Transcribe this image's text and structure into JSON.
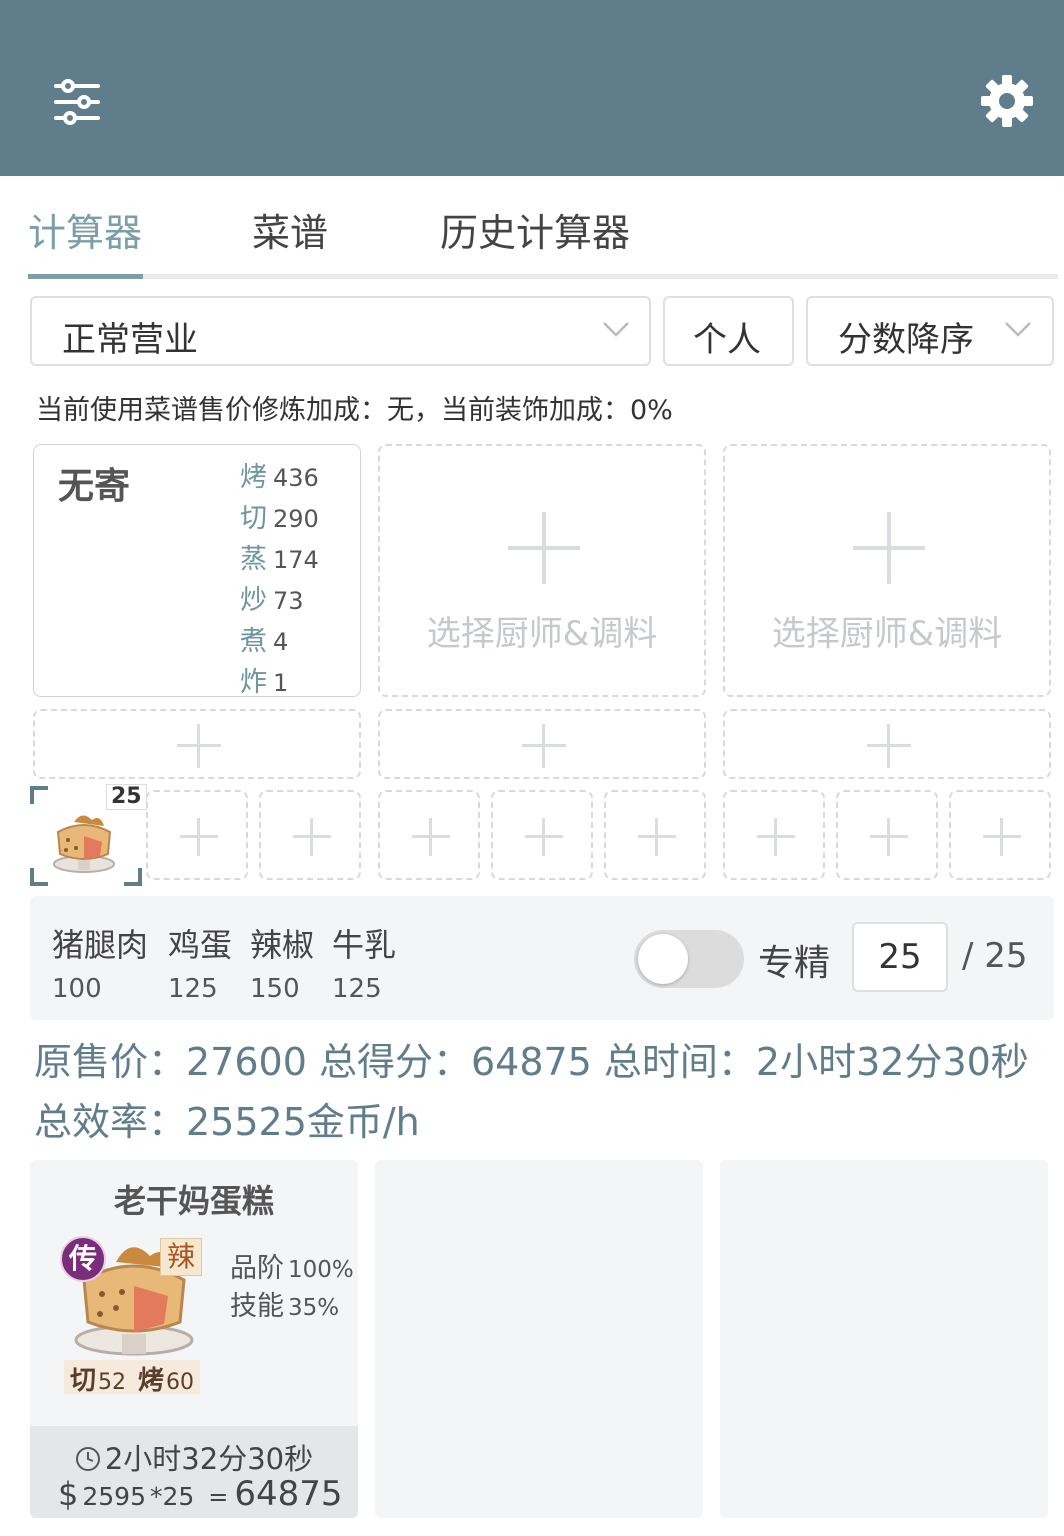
{
  "colors": {
    "header": "#607d8b",
    "accent": "#7b9ea8",
    "panel": "#f4f5f7",
    "rarity": "#7a2d7a"
  },
  "header": {
    "left_icon": "sliders-icon",
    "right_icon": "gear-icon"
  },
  "tabs": [
    {
      "label": "计算器",
      "active": true
    },
    {
      "label": "菜谱",
      "active": false
    },
    {
      "label": "历史计算器",
      "active": false
    }
  ],
  "filters": {
    "mode": "正常营业",
    "scope": "个人",
    "sort": "分数降序"
  },
  "info_line": "当前使用菜谱售价修炼加成：无，当前装饰加成：0%",
  "chefs": [
    {
      "name": "无寄",
      "skills": [
        {
          "label": "烤",
          "value": "436"
        },
        {
          "label": "切",
          "value": "290"
        },
        {
          "label": "蒸",
          "value": "174"
        },
        {
          "label": "炒",
          "value": "73"
        },
        {
          "label": "煮",
          "value": "4"
        },
        {
          "label": "炸",
          "value": "1"
        }
      ]
    },
    {
      "placeholder": "选择厨师&调料"
    },
    {
      "placeholder": "选择厨师&调料"
    }
  ],
  "selected_dish": {
    "quantity": "25"
  },
  "ingredients": [
    {
      "name": "猪腿肉",
      "qty": "100"
    },
    {
      "name": "鸡蛋",
      "qty": "125"
    },
    {
      "name": "辣椒",
      "qty": "150"
    },
    {
      "name": "牛乳",
      "qty": "125"
    }
  ],
  "specialize": {
    "label": "专精",
    "enabled": false,
    "count": "25",
    "max": "/ 25"
  },
  "summary": "原售价：27600 总得分：64875 总时间：2小时32分30秒 总效率：25525金币/h",
  "result": {
    "title": "老干妈蛋糕",
    "rarity": "传",
    "flavor": "辣",
    "grade_label": "品阶",
    "grade_value": "100%",
    "skill_label": "技能",
    "skill_value": "35%",
    "requirements": [
      {
        "label": "切",
        "value": "52"
      },
      {
        "label": "烤",
        "value": "60"
      }
    ],
    "time": "2小时32分30秒",
    "currency": "$",
    "unit_price": "2595",
    "multiplier": "*25",
    "equals": "=",
    "total": "64875"
  }
}
